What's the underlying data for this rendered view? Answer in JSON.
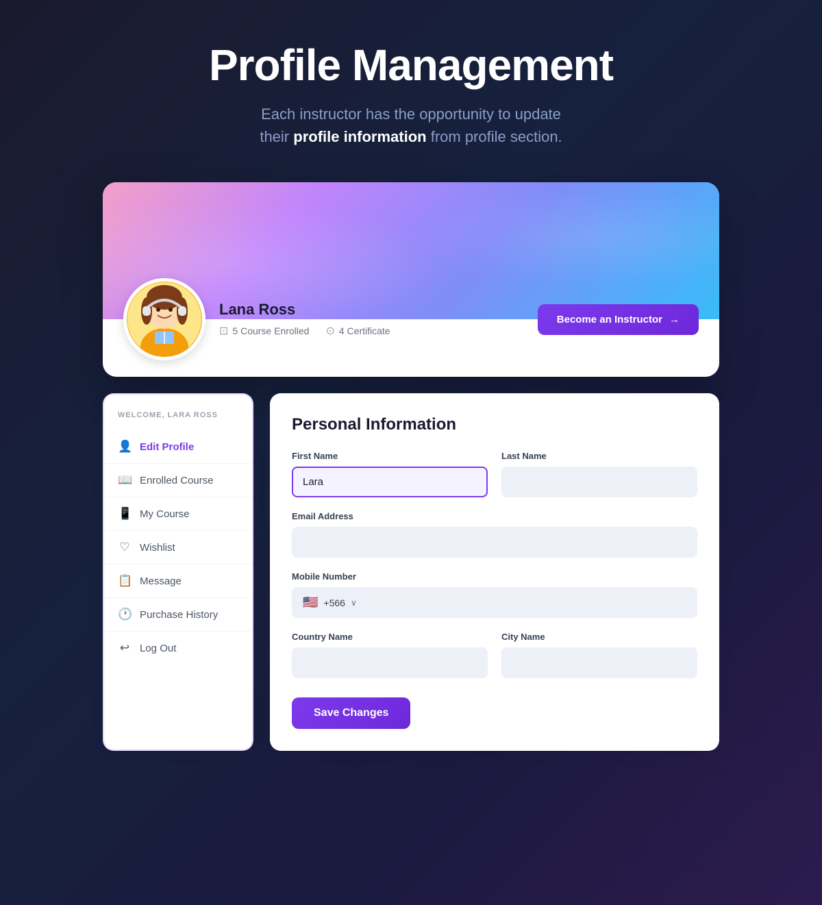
{
  "header": {
    "title": "Profile Management",
    "subtitle_start": "Each instructor has the opportunity to update\n    their ",
    "subtitle_bold": "profile information",
    "subtitle_end": " from profile section."
  },
  "profile": {
    "name": "Lana Ross",
    "courses_enrolled_label": "5 Course Enrolled",
    "certificates_label": "4 Certificate",
    "become_instructor_btn": "Become an Instructor"
  },
  "sidebar": {
    "welcome_label": "WELCOME, LARA ROSS",
    "nav_items": [
      {
        "label": "Edit Profile",
        "icon": "👤",
        "active": true
      },
      {
        "label": "Enrolled Course",
        "icon": "📖"
      },
      {
        "label": "My Course",
        "icon": "📱"
      },
      {
        "label": "Wishlist",
        "icon": "♡"
      },
      {
        "label": "Message",
        "icon": "📋"
      },
      {
        "label": "Purchase History",
        "icon": "🕐"
      },
      {
        "label": "Log Out",
        "icon": "↩"
      }
    ]
  },
  "form": {
    "title": "Personal Information",
    "first_name_label": "First Name",
    "first_name_value": "Lara",
    "last_name_label": "Last Name",
    "last_name_value": "",
    "email_label": "Email Address",
    "email_value": "",
    "mobile_label": "Mobile Number",
    "mobile_flag": "🇺🇸",
    "mobile_code": "+566",
    "mobile_value": "",
    "country_label": "Country Name",
    "country_value": "",
    "city_label": "City Name",
    "city_value": "",
    "save_btn_label": "Save Changes"
  },
  "icons": {
    "arrow_right": "→",
    "chevron_down": "∨",
    "book_icon": "📖",
    "certificate_icon": "🏅"
  }
}
